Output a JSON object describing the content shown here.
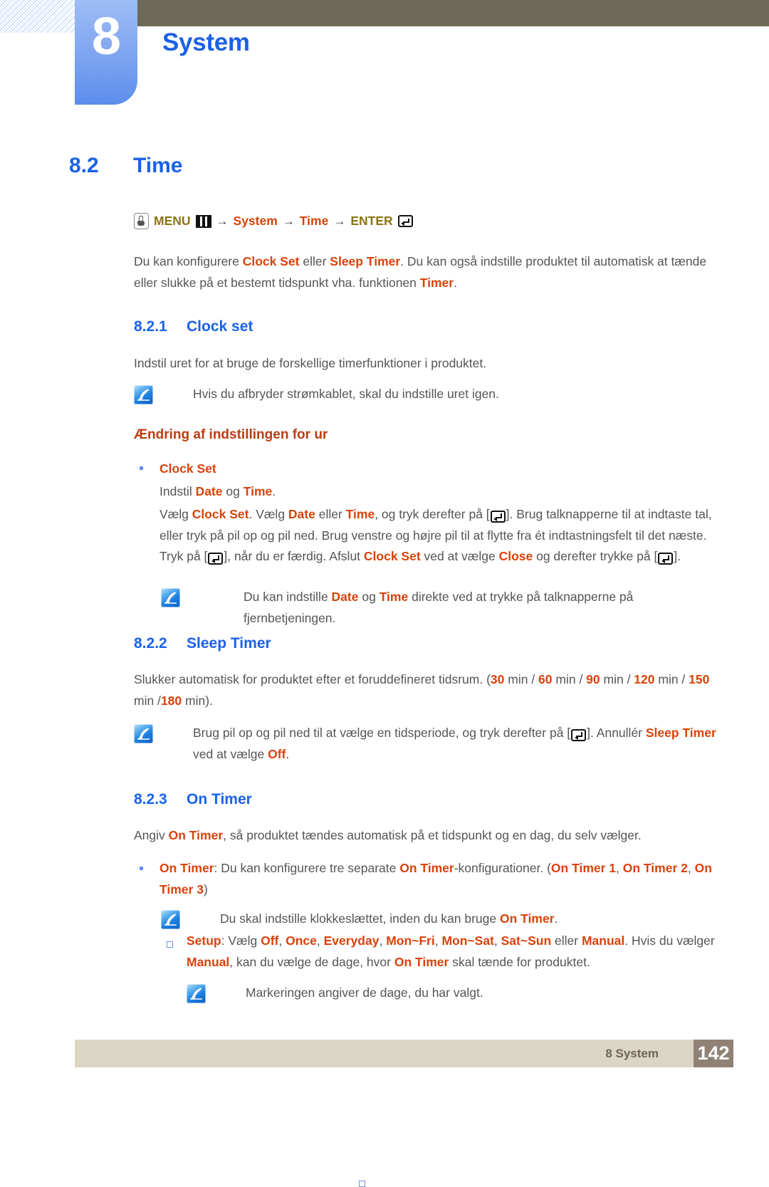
{
  "header": {
    "chapter_number": "8",
    "chapter_title": "System"
  },
  "section": {
    "number": "8.2",
    "title": "Time"
  },
  "menu_path": {
    "hand_icon": "hand-press-icon",
    "menu_label": "MENU",
    "menu_icon": "menu-bars-icon",
    "arrow1": "→",
    "step1": "System",
    "arrow2": "→",
    "step2": "Time",
    "arrow3": "→",
    "enter_label": "ENTER",
    "enter_icon": "enter-key-icon"
  },
  "intro": {
    "l1_a": "Du kan konfigurere ",
    "l1_h1": "Clock Set",
    "l1_b": " eller ",
    "l1_h2": "Sleep Timer",
    "l1_c": ". Du kan også indstille produktet til automatisk at tænde",
    "l2_a": "eller slukke på et bestemt tidspunkt vha. funktionen ",
    "l2_h1": "Timer",
    "l2_b": "."
  },
  "sub1": {
    "number": "8.2.1",
    "title": "Clock set",
    "body": "Indstil uret for at bruge de forskellige timerfunktioner i produktet.",
    "note1": "Hvis du afbryder strømkablet, skal du indstille uret igen.",
    "heading": "Ændring af indstillingen for ur",
    "bullet1_label": "Clock Set",
    "line_a_pre": "Indstil ",
    "line_a_h1": "Date",
    "line_a_mid": " og ",
    "line_a_h2": "Time",
    "line_a_post": ".",
    "p1_1a": "Vælg ",
    "p1_1h1": "Clock Set",
    "p1_1b": ". Vælg ",
    "p1_1h2": "Date",
    "p1_1c": " eller ",
    "p1_1h3": "Time",
    "p1_1d": ", og tryk derefter på [",
    "p1_1e": "]. Brug talknapperne til at indtaste tal,",
    "p1_2": "eller tryk på pil op og pil ned. Brug venstre og højre pil til at flytte fra ét indtastningsfelt til det næste.",
    "p1_3a": "Tryk på [",
    "p1_3b": "], når du er færdig. Afslut ",
    "p1_3h1": "Clock Set",
    "p1_3c": " ved at vælge ",
    "p1_3h2": "Close",
    "p1_3d": " og derefter trykke på [",
    "p1_3e": "].",
    "note2_a": "Du kan indstille ",
    "note2_h1": "Date",
    "note2_b": " og ",
    "note2_h2": "Time",
    "note2_c": " direkte ved at trykke på talknapperne på fjernbetjeningen."
  },
  "sub2": {
    "number": "8.2.2",
    "title": "Sleep Timer",
    "p_a": "Slukker automatisk for produktet efter et foruddefineret tidsrum. (",
    "v1": "30",
    "p_b": " min / ",
    "v2": "60",
    "p_c": " min / ",
    "v3": "90",
    "p_d": " min / ",
    "v4": "120",
    "p_e": " min /",
    "v5": "150",
    "p_f": " min /",
    "v6": "180",
    "p_g": " min).",
    "note_a": "Brug pil op og pil ned til at vælge en tidsperiode, og tryk derefter på [",
    "note_b": "]. Annullér ",
    "note_h1": "Sleep Timer",
    "note_c": " ved at",
    "note_d": "vælge ",
    "note_h2": "Off",
    "note_e": "."
  },
  "sub3": {
    "number": "8.2.3",
    "title": "On Timer",
    "p_a": "Angiv ",
    "p_h1": "On Timer",
    "p_b": ", så produktet tændes automatisk på et tidspunkt og en dag, du selv vælger.",
    "b1_h1": "On Timer",
    "b1_a": ": Du kan konfigurere tre separate ",
    "b1_h2": "On Timer",
    "b1_b": "-konfigurationer. (",
    "b1_h3": "On Timer 1",
    "b1_c": ", ",
    "b1_h4": "On Timer 2",
    "b1_d": ", ",
    "b1_h5": "On",
    "b1_h6": "Timer 3",
    "b1_e": ")",
    "note1_a": "Du skal indstille klokkeslættet, inden du kan bruge ",
    "note1_h1": "On Timer",
    "note1_b": ".",
    "setup_label": "Setup",
    "setup_a": ": Vælg ",
    "o1": "Off",
    "sep1": ", ",
    "o2": "Once",
    "sep2": ", ",
    "o3": "Everyday",
    "sep3": ", ",
    "o4": "Mon~Fri",
    "sep4": ", ",
    "o5": "Mon~Sat",
    "sep5": ", ",
    "o6": "Sat~Sun",
    "sep6": " eller ",
    "o7": "Manual",
    "setup_b": ". Hvis du",
    "setup_c": "vælger ",
    "o8": "Manual",
    "setup_d": ", kan du vælge de dage, hvor ",
    "o9": "On Timer",
    "setup_e": " skal tænde for produktet.",
    "note2": "Markeringen angiver de dage, du har valgt."
  },
  "footer": {
    "label": "8 System",
    "page_number": "142"
  },
  "colors": {
    "accent_blue": "#1b61e8",
    "highlight_orange": "#d9420b",
    "header_bar": "#6d6b58",
    "footer_bar": "#dbd6c4",
    "footer_page_box": "#8f8275",
    "olive": "#8a7416"
  }
}
